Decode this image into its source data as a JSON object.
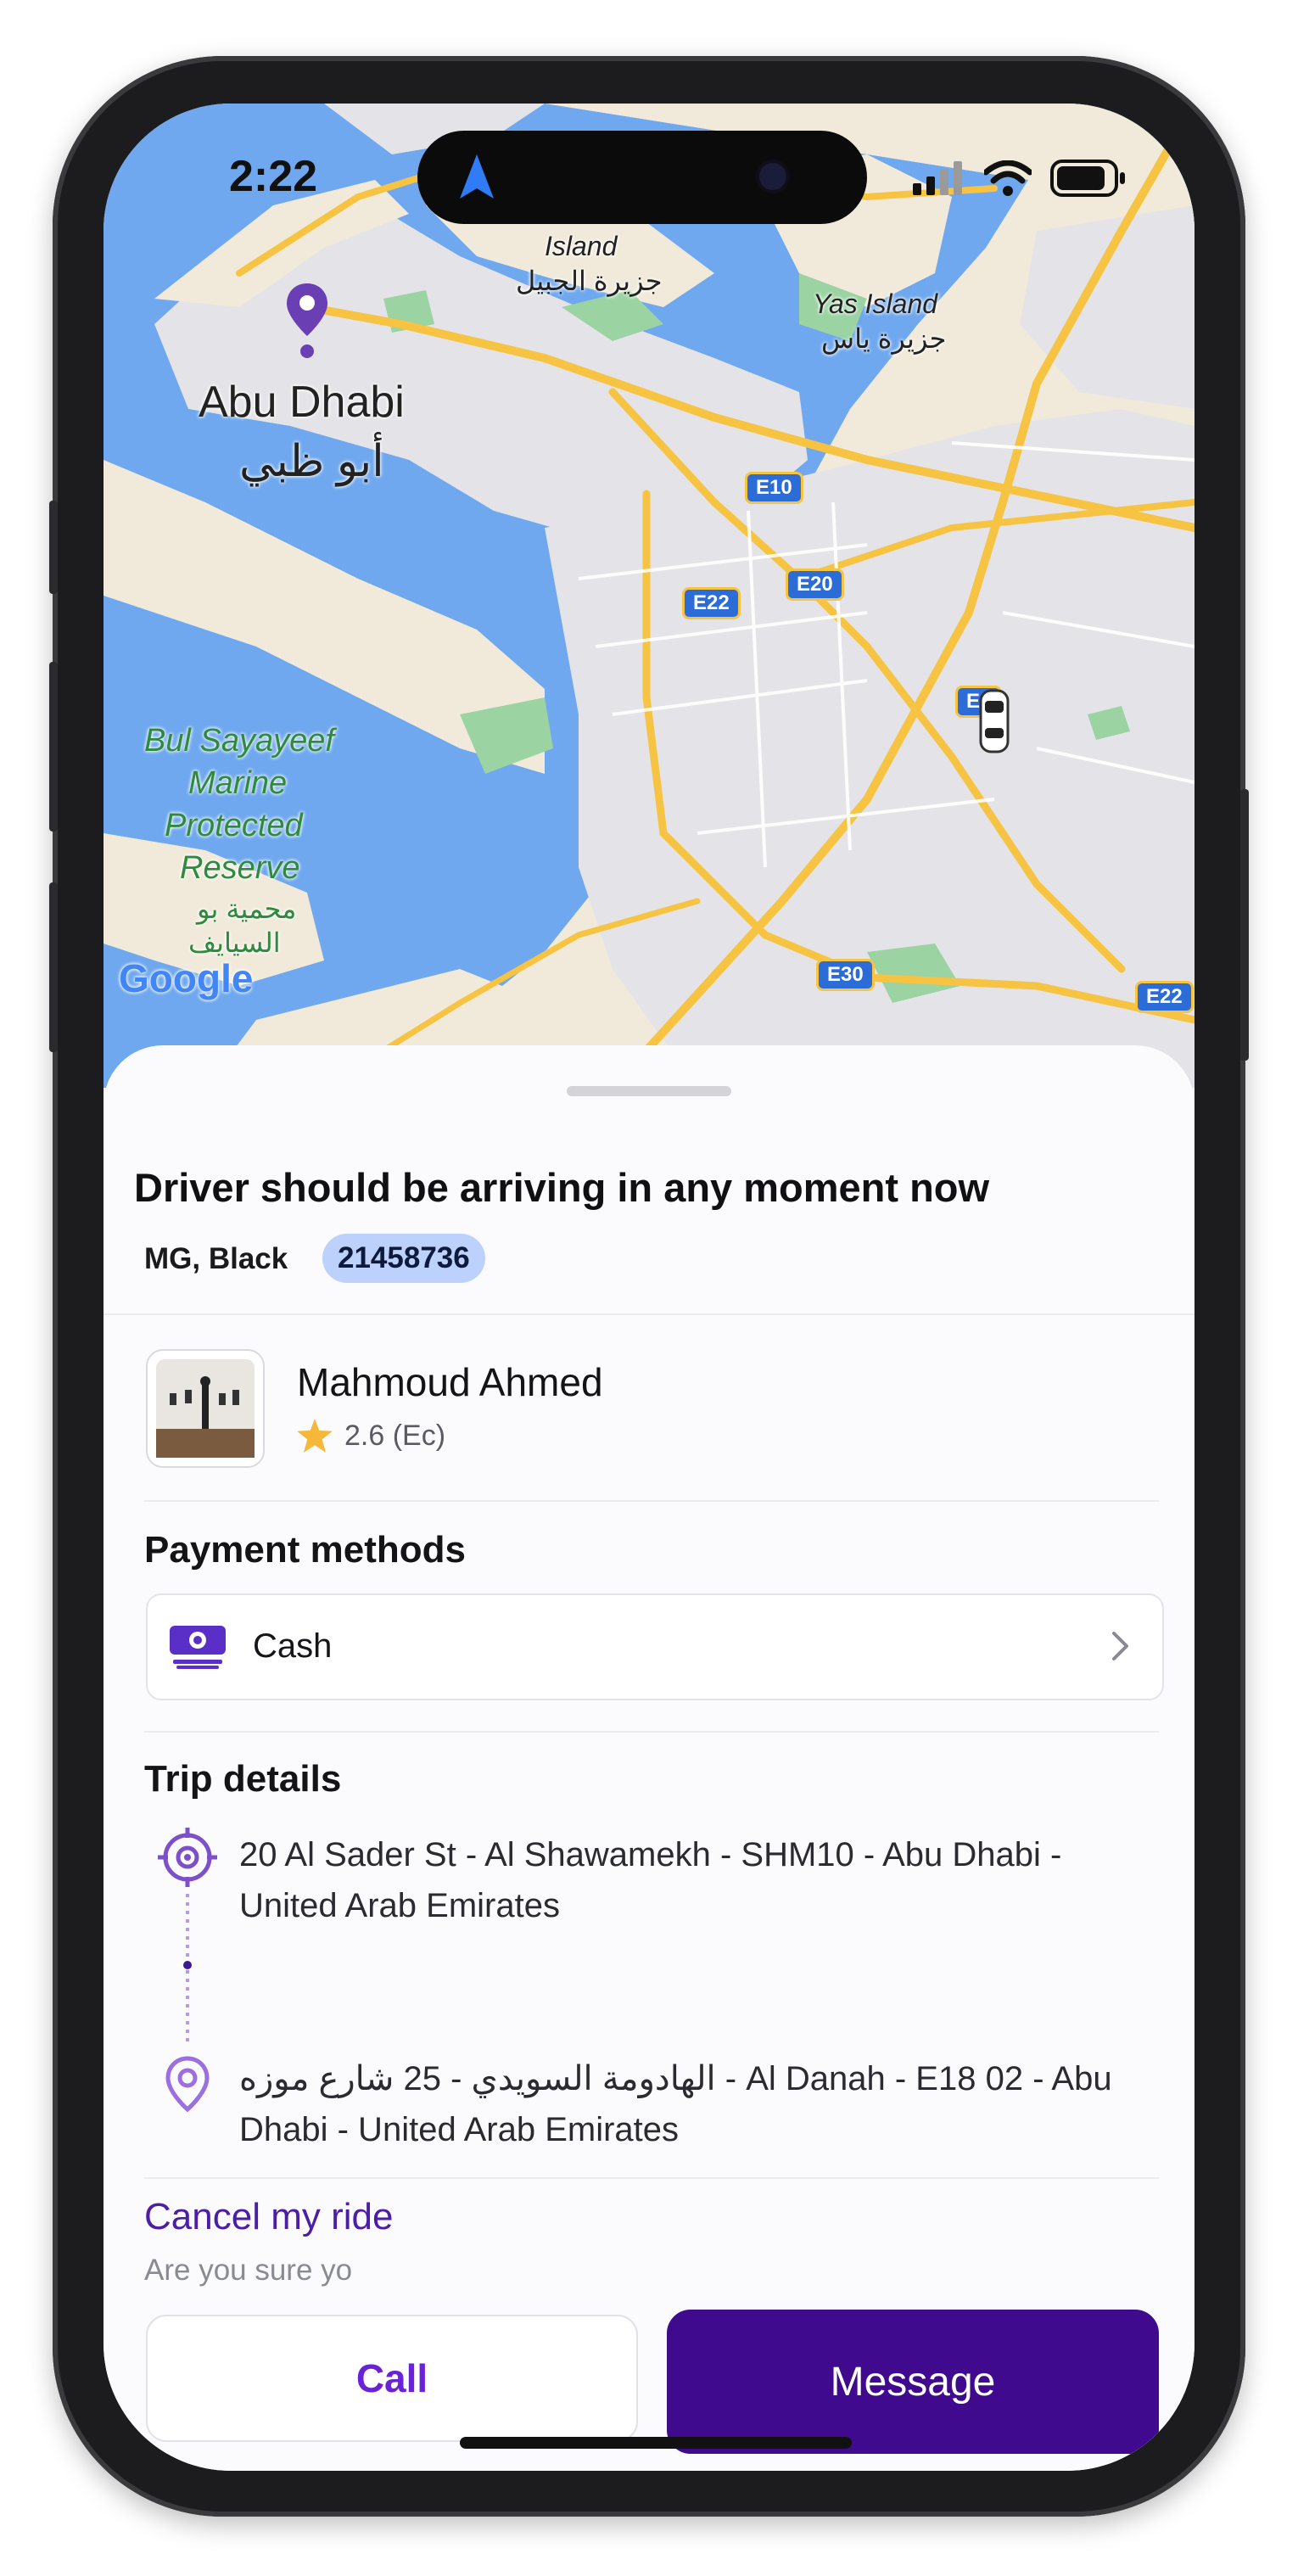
{
  "status_bar": {
    "time": "2:22"
  },
  "map": {
    "labels": {
      "island": "Island",
      "island_ar": "جزيرة الجبيل",
      "yas_island": "Yas Island",
      "yas_island_ar": "جزيرة ياس",
      "city": "Abu Dhabi",
      "city_ar": "أبو ظبي",
      "reserve_line1": "Bul Sayayeef",
      "reserve_line2": "Marine",
      "reserve_line3": "Protected",
      "reserve_line4": "Reserve",
      "reserve_ar1": "محمية بو",
      "reserve_ar2": "السيايف",
      "google": "Google"
    },
    "road_shields": [
      "E10",
      "E20",
      "E22",
      "E30",
      "E22",
      "E1"
    ],
    "colors": {
      "water": "#6fa8ef",
      "land": "#f1eadb",
      "urban": "#e4e4e8",
      "highway": "#f6c342",
      "park": "#9bd3a2"
    }
  },
  "sheet": {
    "headline": "Driver should be arriving in any moment now",
    "car": "MG, Black",
    "plate": "21458736",
    "driver": {
      "name": "Mahmoud Ahmed",
      "rating": "2.6 (Ec)"
    },
    "payment": {
      "title": "Payment methods",
      "method": "Cash"
    },
    "trip": {
      "title": "Trip details",
      "pickup": "20 Al Sader St - Al Shawamekh - SHM10 - Abu Dhabi - United Arab Emirates",
      "dropoff": "الهادومة السويدي - 25 شارع موزه - Al Danah - E18 02 - Abu Dhabi - United Arab Emirates"
    },
    "cancel": {
      "label": "Cancel my ride",
      "sub": "Are you sure yo"
    },
    "actions": {
      "call": "Call",
      "message": "Message"
    }
  }
}
